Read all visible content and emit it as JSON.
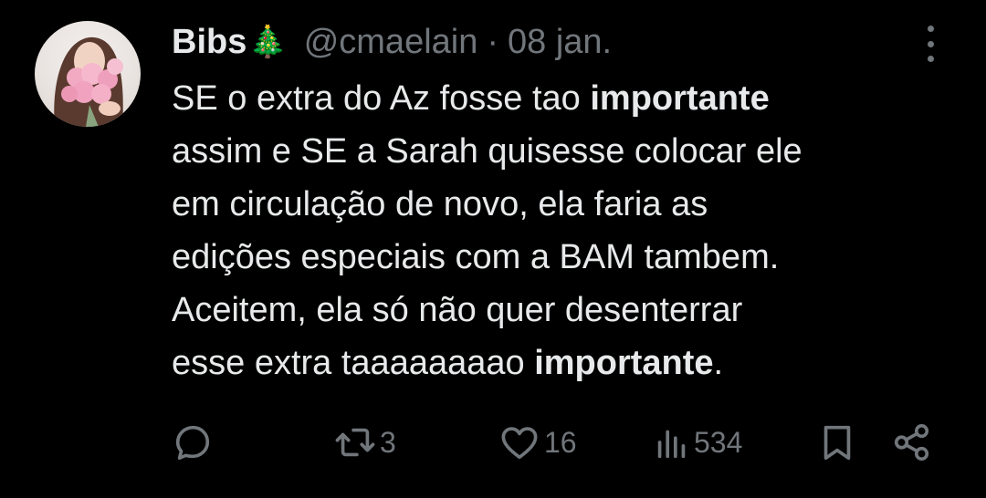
{
  "tweet": {
    "author": {
      "name": "Bibs",
      "emoji": "🎄",
      "handle": "@cmaelain",
      "separator": "·",
      "date": "08 jan."
    },
    "text": {
      "l1a": "SE o extra do Az fosse tao ",
      "l1b": "importante",
      "l2": "assim e SE a Sarah quisesse colocar ele",
      "l3": "em circulação de novo, ela faria as",
      "l4": "edições especiais com a BAM tambem.",
      "l5": "Aceitem, ela só não quer desenterrar",
      "l6a": "esse extra taaaaaaaao ",
      "l6b": "importante",
      "l6c": "."
    },
    "stats": {
      "reposts": "3",
      "likes": "16",
      "views": "534"
    }
  },
  "icons": {
    "more": "more-vertical-icon",
    "reply": "reply-icon",
    "repost": "repost-icon",
    "like": "heart-icon",
    "views": "views-icon",
    "bookmark": "bookmark-icon",
    "share": "share-icon"
  },
  "colors": {
    "background": "#000000",
    "text": "#e7e9ea",
    "muted": "#71767b"
  }
}
